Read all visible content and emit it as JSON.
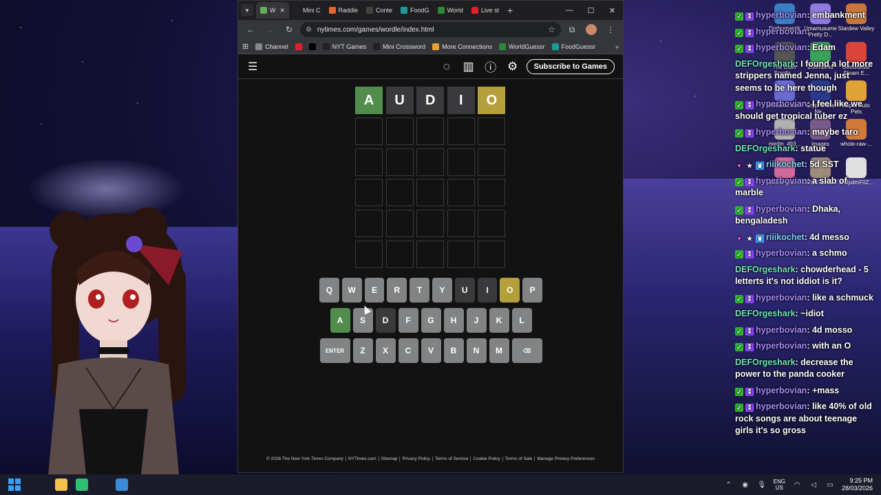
{
  "browser": {
    "tabs": [
      {
        "label": "W",
        "favicon": "wordle-favicon",
        "color": "#6aaa64",
        "active": true
      },
      {
        "label": "Mini C",
        "favicon": "nyt-favicon",
        "color": "#222222"
      },
      {
        "label": "Raddle",
        "favicon": "raddle-favicon",
        "color": "#e06b2a"
      },
      {
        "label": "Conte",
        "favicon": "contexto-favicon",
        "color": "#444444"
      },
      {
        "label": "FoodG",
        "favicon": "foodguessr-favicon",
        "color": "#1d9b9b"
      },
      {
        "label": "World",
        "favicon": "worldguessr-favicon",
        "color": "#2a8a3a"
      },
      {
        "label": "Live st",
        "favicon": "youtube-favicon",
        "color": "#e0202a"
      }
    ],
    "url": "nytimes.com/games/wordle/index.html",
    "bookmarks": [
      {
        "label": "Channel",
        "icon": "folder-icon"
      },
      {
        "label": "",
        "icon": "youtube-icon"
      },
      {
        "label": "",
        "icon": "x-icon"
      },
      {
        "label": "NYT Games",
        "icon": "nyt-icon"
      },
      {
        "label": "Mini Crossword",
        "icon": "nyt-icon"
      },
      {
        "label": "More Connections",
        "icon": "grid-icon"
      },
      {
        "label": "WorldGuessr",
        "icon": "globe-icon"
      },
      {
        "label": "FoodGuessr",
        "icon": "food-icon"
      }
    ]
  },
  "nyt": {
    "subscribe_label": "Subscribe to Games"
  },
  "wordle": {
    "board": [
      [
        {
          "l": "A",
          "s": "correct"
        },
        {
          "l": "U",
          "s": "absent"
        },
        {
          "l": "D",
          "s": "absent"
        },
        {
          "l": "I",
          "s": "absent"
        },
        {
          "l": "O",
          "s": "present"
        }
      ],
      [
        {
          "l": "",
          "s": "empty"
        },
        {
          "l": "",
          "s": "empty"
        },
        {
          "l": "",
          "s": "empty"
        },
        {
          "l": "",
          "s": "empty"
        },
        {
          "l": "",
          "s": "empty"
        }
      ],
      [
        {
          "l": "",
          "s": "empty"
        },
        {
          "l": "",
          "s": "empty"
        },
        {
          "l": "",
          "s": "empty"
        },
        {
          "l": "",
          "s": "empty"
        },
        {
          "l": "",
          "s": "empty"
        }
      ],
      [
        {
          "l": "",
          "s": "empty"
        },
        {
          "l": "",
          "s": "empty"
        },
        {
          "l": "",
          "s": "empty"
        },
        {
          "l": "",
          "s": "empty"
        },
        {
          "l": "",
          "s": "empty"
        }
      ],
      [
        {
          "l": "",
          "s": "empty"
        },
        {
          "l": "",
          "s": "empty"
        },
        {
          "l": "",
          "s": "empty"
        },
        {
          "l": "",
          "s": "empty"
        },
        {
          "l": "",
          "s": "empty"
        }
      ],
      [
        {
          "l": "",
          "s": "empty"
        },
        {
          "l": "",
          "s": "empty"
        },
        {
          "l": "",
          "s": "empty"
        },
        {
          "l": "",
          "s": "empty"
        },
        {
          "l": "",
          "s": "empty"
        }
      ]
    ],
    "keyboard": [
      [
        {
          "k": "Q",
          "s": "unused"
        },
        {
          "k": "W",
          "s": "unused"
        },
        {
          "k": "E",
          "s": "unused"
        },
        {
          "k": "R",
          "s": "unused"
        },
        {
          "k": "T",
          "s": "unused"
        },
        {
          "k": "Y",
          "s": "unused"
        },
        {
          "k": "U",
          "s": "absent"
        },
        {
          "k": "I",
          "s": "absent"
        },
        {
          "k": "O",
          "s": "present"
        },
        {
          "k": "P",
          "s": "unused"
        }
      ],
      [
        {
          "k": "A",
          "s": "correct"
        },
        {
          "k": "S",
          "s": "unused"
        },
        {
          "k": "D",
          "s": "absent"
        },
        {
          "k": "F",
          "s": "unused"
        },
        {
          "k": "G",
          "s": "unused"
        },
        {
          "k": "H",
          "s": "unused"
        },
        {
          "k": "J",
          "s": "unused"
        },
        {
          "k": "K",
          "s": "unused"
        },
        {
          "k": "L",
          "s": "unused"
        }
      ],
      [
        {
          "k": "ENTER",
          "s": "unused",
          "wide": true
        },
        {
          "k": "Z",
          "s": "unused"
        },
        {
          "k": "X",
          "s": "unused"
        },
        {
          "k": "C",
          "s": "unused"
        },
        {
          "k": "V",
          "s": "unused"
        },
        {
          "k": "B",
          "s": "unused"
        },
        {
          "k": "N",
          "s": "unused"
        },
        {
          "k": "M",
          "s": "unused"
        },
        {
          "k": "⌫",
          "s": "unused",
          "wide": true,
          "name": "backspace"
        }
      ]
    ],
    "colors": {
      "correct": "#538d4e",
      "present": "#b59f3b",
      "absent": "#3a3a3c",
      "unused": "#818384"
    }
  },
  "footer": [
    "© 2026 The New York Times Company",
    "NYTimes.com",
    "Sitemap",
    "Privacy Policy",
    "Terms of Service",
    "Cookie Policy",
    "Terms of Sale",
    "Manage Privacy Preferences"
  ],
  "desktop_icons": [
    {
      "label": "Dorfromantik",
      "color": "#3a7fc1"
    },
    {
      "label": "Umamusume Pretty D...",
      "color": "#8f7ae0"
    },
    {
      "label": "Stardew Valley",
      "color": "#c9783a"
    },
    {
      "label": "The Elder Scrolls...",
      "color": "#555555"
    },
    {
      "label": "Zoombinis",
      "color": "#3aa35a"
    },
    {
      "label": "GeoGuessr Steam E...",
      "color": "#d9453a"
    },
    {
      "label": "onwards.stu...",
      "color": "#6a6ad0"
    },
    {
      "label": "Crypt of the Ne...",
      "color": "#2a3a8a"
    },
    {
      "label": "Super Auto Pets",
      "color": "#e2a23a"
    },
    {
      "label": "merlin_493...",
      "color": "#b0b0b0"
    },
    {
      "label": "images",
      "color": "#7a5a8a"
    },
    {
      "label": "whole-raw-...",
      "color": "#d07a3a"
    },
    {
      "label": "ariana-gran...",
      "color": "#d06a9a"
    },
    {
      "label": "0f7cfc71263...",
      "color": "#a08a7a"
    },
    {
      "label": "cHJpdmF0Z...",
      "color": "#e0e0e0"
    }
  ],
  "chat": [
    {
      "user": "hyperbovian",
      "color": "#a78bfa",
      "badges": [
        "check",
        "sub"
      ],
      "text": "embankment"
    },
    {
      "user": "hyperbovian",
      "color": "#a78bfa",
      "badges": [
        "check",
        "sub"
      ],
      "text": ""
    },
    {
      "user": "hyperbovian",
      "color": "#a78bfa",
      "badges": [
        "check",
        "sub"
      ],
      "text": "Edam"
    },
    {
      "user": "DEFOrgeshark",
      "color": "#6ee7b7",
      "badges": [],
      "text": "I found a lot more strippers named Jenna, just seems to be here though"
    },
    {
      "user": "hyperbovian",
      "color": "#a78bfa",
      "badges": [
        "check",
        "sub"
      ],
      "text": "I feel like we should get tropical tuber ez"
    },
    {
      "user": "hyperbovian",
      "color": "#a78bfa",
      "badges": [
        "check",
        "sub"
      ],
      "text": "maybe taro"
    },
    {
      "user": "DEFOrgeshark",
      "color": "#6ee7b7",
      "badges": [],
      "text": "statue"
    },
    {
      "user": "riiikochet",
      "color": "#7dd3fc",
      "badges": [
        "heart",
        "star",
        "crown"
      ],
      "text": "5d SST"
    },
    {
      "user": "hyperbovian",
      "color": "#a78bfa",
      "badges": [
        "check",
        "sub"
      ],
      "text": "a slab of marble"
    },
    {
      "user": "hyperbovian",
      "color": "#a78bfa",
      "badges": [
        "check",
        "sub"
      ],
      "text": "Dhaka, bengaladesh"
    },
    {
      "user": "riiikochet",
      "color": "#7dd3fc",
      "badges": [
        "heart",
        "star",
        "crown"
      ],
      "text": "4d messo"
    },
    {
      "user": "hyperbovian",
      "color": "#a78bfa",
      "badges": [
        "check",
        "sub"
      ],
      "text": "a schmo"
    },
    {
      "user": "DEFOrgeshark",
      "color": "#6ee7b7",
      "badges": [],
      "text": "chowderhead - 5 letterts it's not iddiot is it?"
    },
    {
      "user": "hyperbovian",
      "color": "#a78bfa",
      "badges": [
        "check",
        "sub"
      ],
      "text": "like a schmuck"
    },
    {
      "user": "DEFOrgeshark",
      "color": "#6ee7b7",
      "badges": [],
      "text": "~idiot"
    },
    {
      "user": "hyperbovian",
      "color": "#a78bfa",
      "badges": [
        "check",
        "sub"
      ],
      "text": "4d mosso"
    },
    {
      "user": "hyperbovian",
      "color": "#a78bfa",
      "badges": [
        "check",
        "sub"
      ],
      "text": "with an O"
    },
    {
      "user": "DEFOrgeshark",
      "color": "#6ee7b7",
      "badges": [],
      "text": "decrease the power to the panda cooker"
    },
    {
      "user": "hyperbovian",
      "color": "#a78bfa",
      "badges": [
        "check",
        "sub"
      ],
      "text": "+mass"
    },
    {
      "user": "hyperbovian",
      "color": "#a78bfa",
      "badges": [
        "check",
        "sub"
      ],
      "text": "like 40% of old rock songs are about teenage girls it's so gross"
    }
  ],
  "taskbar": {
    "lang_top": "ENG",
    "lang_bottom": "US",
    "time": "9:25 PM",
    "date": "28/03/2026"
  }
}
